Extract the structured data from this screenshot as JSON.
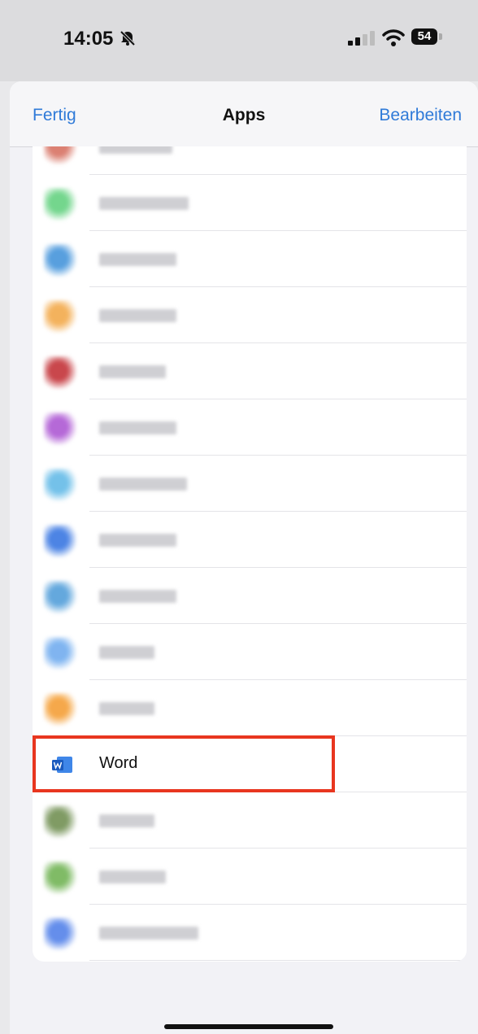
{
  "status_bar": {
    "time": "14:05",
    "battery_level": "54",
    "icons": [
      "bell-slash-icon",
      "cellular-signal-icon",
      "wifi-icon",
      "battery-icon"
    ]
  },
  "nav": {
    "left_label": "Fertig",
    "title": "Apps",
    "right_label": "Bearbeiten"
  },
  "apps": [
    {
      "label": "",
      "blurred": true,
      "icon_color": "#d56a5a"
    },
    {
      "label": "",
      "blurred": true,
      "icon_color": "#5ccf7a"
    },
    {
      "label": "",
      "blurred": true,
      "icon_color": "#3b8fd9"
    },
    {
      "label": "",
      "blurred": true,
      "icon_color": "#f2a541"
    },
    {
      "label": "",
      "blurred": true,
      "icon_color": "#c0272d"
    },
    {
      "label": "",
      "blurred": true,
      "icon_color": "#a94fd1"
    },
    {
      "label": "",
      "blurred": true,
      "icon_color": "#5cb7e6"
    },
    {
      "label": "",
      "blurred": true,
      "icon_color": "#2e6fe0"
    },
    {
      "label": "",
      "blurred": true,
      "icon_color": "#4a9ad8"
    },
    {
      "label": "",
      "blurred": true,
      "icon_color": "#6aa8ee"
    },
    {
      "label": "",
      "blurred": true,
      "icon_color": "#f49a2c"
    },
    {
      "label": "Word",
      "blurred": false,
      "icon_color": "#1b5bbf",
      "highlighted": true
    },
    {
      "label": "",
      "blurred": true,
      "icon_color": "#6a8a4a"
    },
    {
      "label": "",
      "blurred": true,
      "icon_color": "#6ab04c"
    },
    {
      "label": "",
      "blurred": true,
      "icon_color": "#4a7be8"
    }
  ],
  "colors": {
    "accent": "#2f7ad8",
    "highlight_border": "#e8361f"
  }
}
